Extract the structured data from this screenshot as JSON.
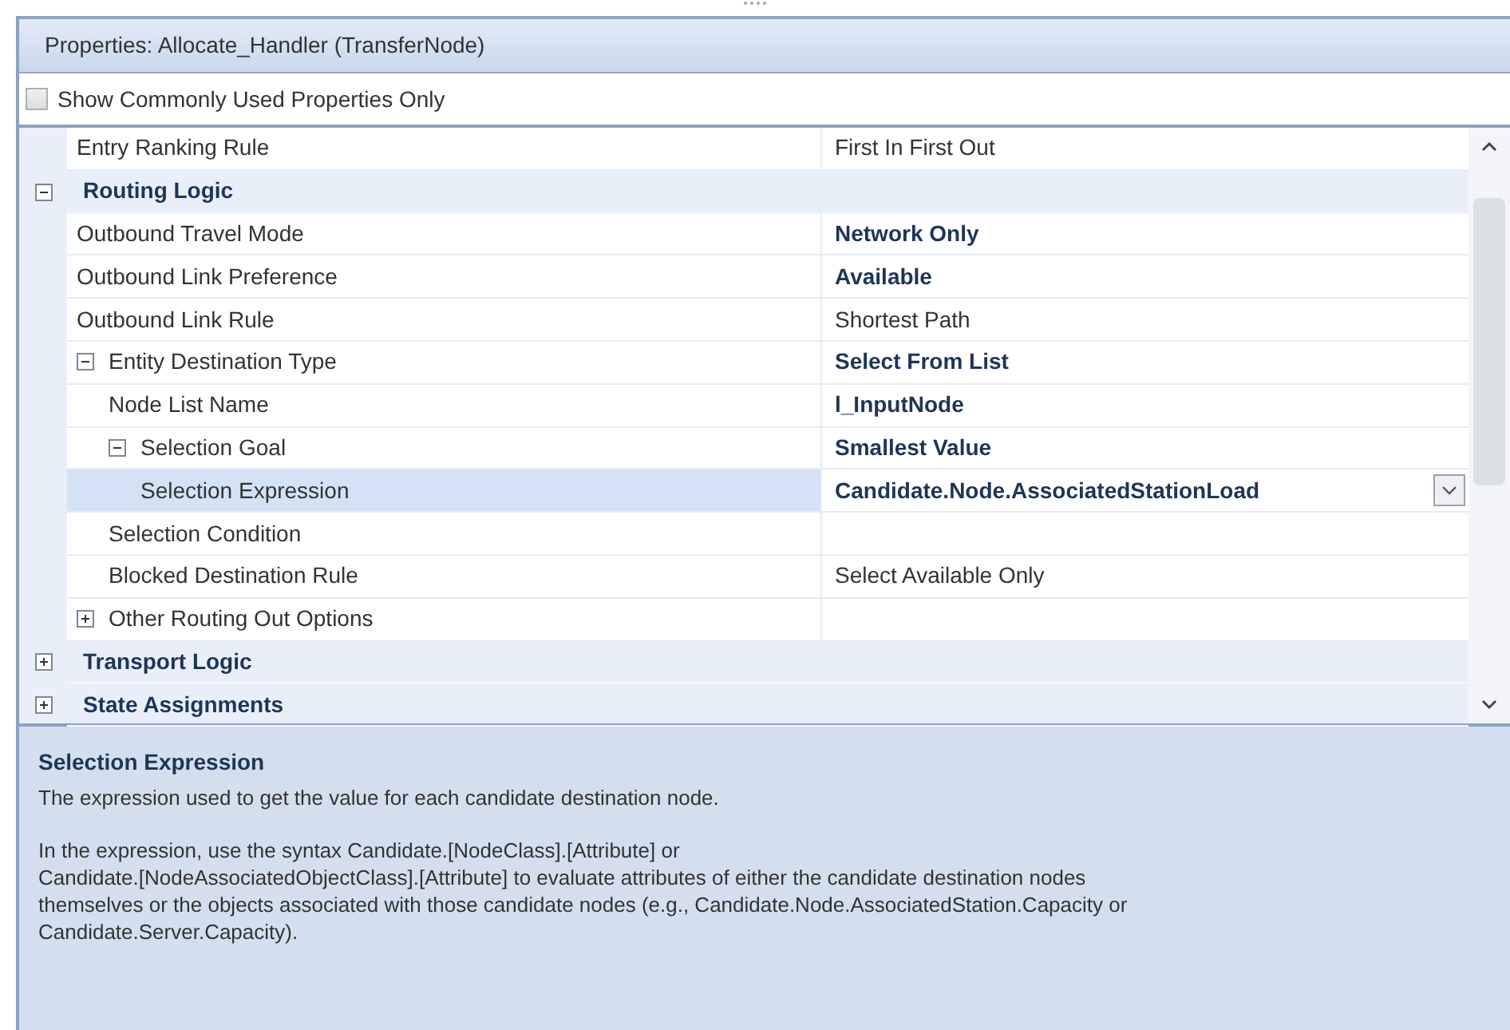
{
  "panel": {
    "title": "Properties: Allocate_Handler (TransferNode)"
  },
  "filter": {
    "label": "Show Commonly Used Properties Only",
    "checked": false
  },
  "properties": [
    {
      "kind": "property",
      "name": "Entry Ranking Rule",
      "value": "First In First Out",
      "changed": false,
      "selected": false
    },
    {
      "kind": "category",
      "name": "Routing Logic",
      "expanded": true,
      "children": [
        {
          "kind": "property",
          "name": "Outbound Travel Mode",
          "value": "Network Only",
          "changed": true,
          "selected": false
        },
        {
          "kind": "property",
          "name": "Outbound Link Preference",
          "value": "Available",
          "changed": true,
          "selected": false
        },
        {
          "kind": "property",
          "name": "Outbound Link Rule",
          "value": "Shortest Path",
          "changed": false,
          "selected": false
        },
        {
          "kind": "property",
          "name": "Entity Destination Type",
          "value": "Select From List",
          "changed": true,
          "selected": false,
          "expanded": true,
          "children": [
            {
              "kind": "property",
              "name": "Node List Name",
              "value": "l_InputNode",
              "changed": true,
              "selected": false
            },
            {
              "kind": "property",
              "name": "Selection Goal",
              "value": "Smallest Value",
              "changed": true,
              "selected": false,
              "expanded": true,
              "children": [
                {
                  "kind": "property",
                  "name": "Selection Expression",
                  "value": "Candidate.Node.AssociatedStationLoad",
                  "changed": true,
                  "selected": true
                }
              ]
            },
            {
              "kind": "property",
              "name": "Selection Condition",
              "selected": false
            },
            {
              "kind": "property",
              "name": "Blocked Destination Rule",
              "value": "Select Available Only",
              "changed": false,
              "selected": false
            }
          ]
        },
        {
          "kind": "property",
          "name": "Other Routing Out Options",
          "selected": false,
          "expanded": false
        }
      ]
    },
    {
      "kind": "category",
      "name": "Transport Logic",
      "expanded": false
    },
    {
      "kind": "category",
      "name": "State Assignments",
      "expanded": false
    }
  ],
  "help": {
    "title": "Selection Expression",
    "summary": "The expression used to get the value for each candidate destination node.",
    "details": "In the expression, use the syntax Candidate.[NodeClass].[Attribute] or\nCandidate.[NodeAssociatedObjectClass].[Attribute] to evaluate attributes of either the candidate destination nodes\nthemselves or the objects associated with those candidate nodes (e.g., Candidate.Node.AssociatedStation.Capacity or\nCandidate.Server.Capacity)."
  }
}
